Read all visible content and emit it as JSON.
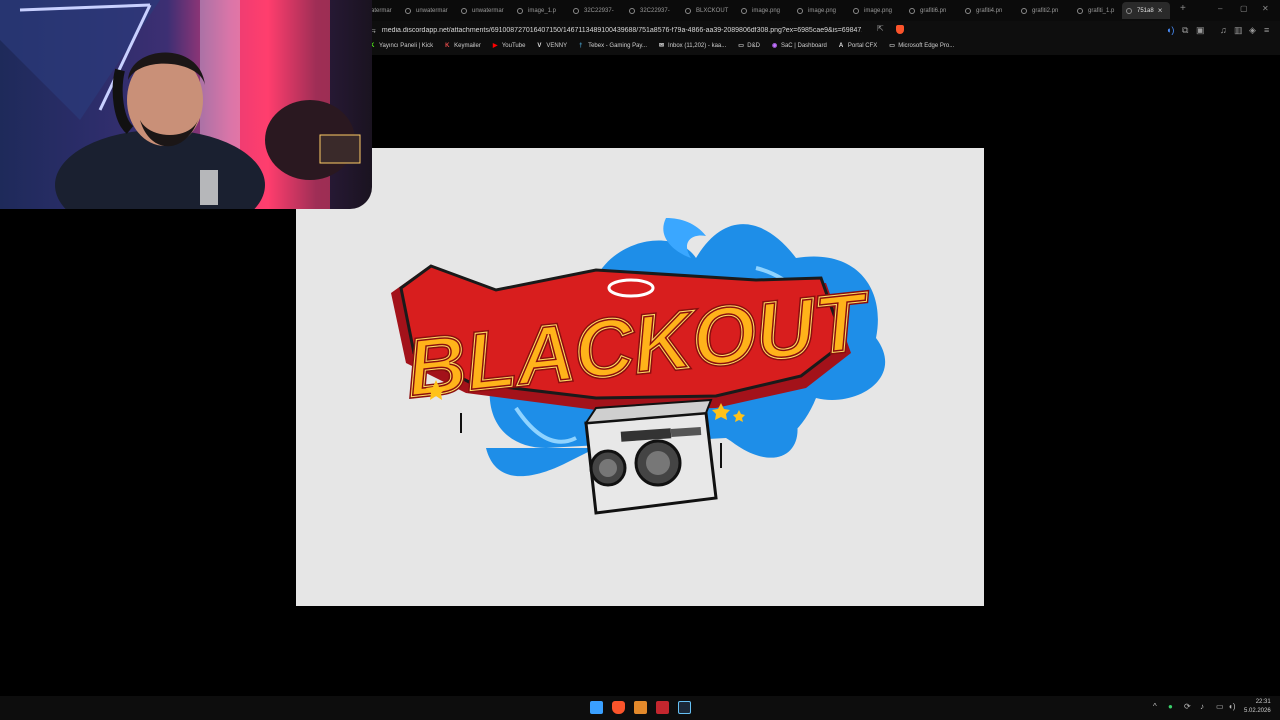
{
  "browser": {
    "tabs": [
      {
        "label": "unwatermar"
      },
      {
        "label": "unwatermar"
      },
      {
        "label": "unwatermar"
      },
      {
        "label": "image_1.p"
      },
      {
        "label": "32C22937-"
      },
      {
        "label": "32C22937-"
      },
      {
        "label": "BLXCKOUT"
      },
      {
        "label": "image.png"
      },
      {
        "label": "image.png"
      },
      {
        "label": "image.png"
      },
      {
        "label": "grafiti6.pn"
      },
      {
        "label": "grafiti4.pn"
      },
      {
        "label": "grafiti2.pn"
      },
      {
        "label": "grafiti_1.p"
      }
    ],
    "active_tab": {
      "label": "751a8"
    },
    "url": "media.discordapp.net/attachments/691008727016407150/1467113489100439688/751a8576-f79a-4866-aa39-2089806df308.png?ex=6985cae9&is=69847...",
    "bookmarks": [
      {
        "label": "Yayıncı Paneli | Kick",
        "color": "#53fc18",
        "icon": "K"
      },
      {
        "label": "Keymailer",
        "color": "#e24a4a",
        "icon": "K"
      },
      {
        "label": "YouTube",
        "color": "#ff0000",
        "icon": "▶"
      },
      {
        "label": "VENNY",
        "color": "#e0e0e0",
        "icon": "V"
      },
      {
        "label": "Tebex - Gaming Pay...",
        "color": "#4fb0e0",
        "icon": "†"
      },
      {
        "label": "Inbox (11,202) - kaa...",
        "color": "#e0e0e0",
        "icon": "✉"
      },
      {
        "label": "D&D",
        "color": "#cfcfcf",
        "icon": "▭"
      },
      {
        "label": "SaC | Dashboard",
        "color": "#c070ff",
        "icon": "◉"
      },
      {
        "label": "Portal CFX",
        "color": "#e0e0e0",
        "icon": "A"
      },
      {
        "label": "Microsoft Edge Pro...",
        "color": "#cfcfcf",
        "icon": "▭"
      }
    ]
  },
  "image": {
    "logo_text": "BLACKOUT"
  },
  "taskbar": {
    "time": "22:31",
    "date": "5.02.2026"
  },
  "colors": {
    "page_background": "#000000",
    "image_background": "#e6e6e6",
    "logo_red": "#d81e1e",
    "logo_orange": "#ff8a00",
    "logo_yellow": "#ffd21a",
    "splash_blue": "#1e8ee8"
  }
}
